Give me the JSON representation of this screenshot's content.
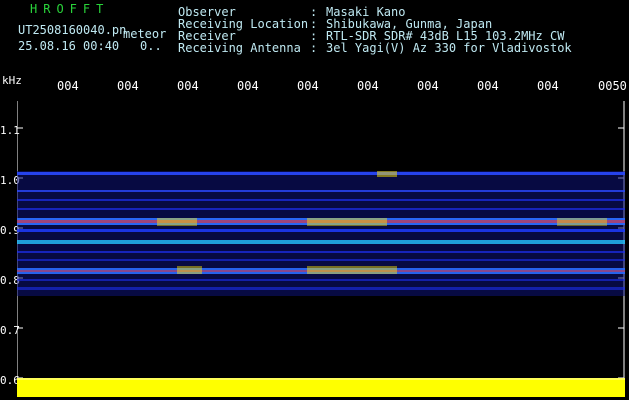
{
  "header": {
    "logo": "HROFFT",
    "filename": "UT2508160040.pn",
    "badge": "meteor",
    "datetime": "25.08.16 00:40",
    "count_value": "0..",
    "fields": [
      {
        "label": "Observer",
        "sep": ":",
        "value": "Masaki Kano"
      },
      {
        "label": "Receiving Location",
        "sep": ":",
        "value": "Shibukawa, Gunma, Japan"
      },
      {
        "label": "Receiver",
        "sep": ":",
        "value": "RTL-SDR SDR# 43dB L15 103.2MHz CW"
      },
      {
        "label": "Receiving Antenna",
        "sep": ":",
        "value": "3el Yagi(V) Az 330 for Vladivostok"
      }
    ]
  },
  "axis": {
    "y_unit": "kHz",
    "y_ticks": [
      "1.1",
      "1.0",
      "0.9",
      "0.8",
      "0.7",
      "0.6"
    ],
    "x_ticks": [
      "004",
      "004",
      "004",
      "004",
      "004",
      "004",
      "004",
      "004",
      "004",
      "0050"
    ]
  },
  "colors": {
    "background": "#000000",
    "header_text": "#bfe9f2",
    "logo": "#29d43a",
    "noise_band": "#1b2bd8",
    "meteor_hot": "#ff2a1a",
    "baseline": "#ffff00"
  }
}
